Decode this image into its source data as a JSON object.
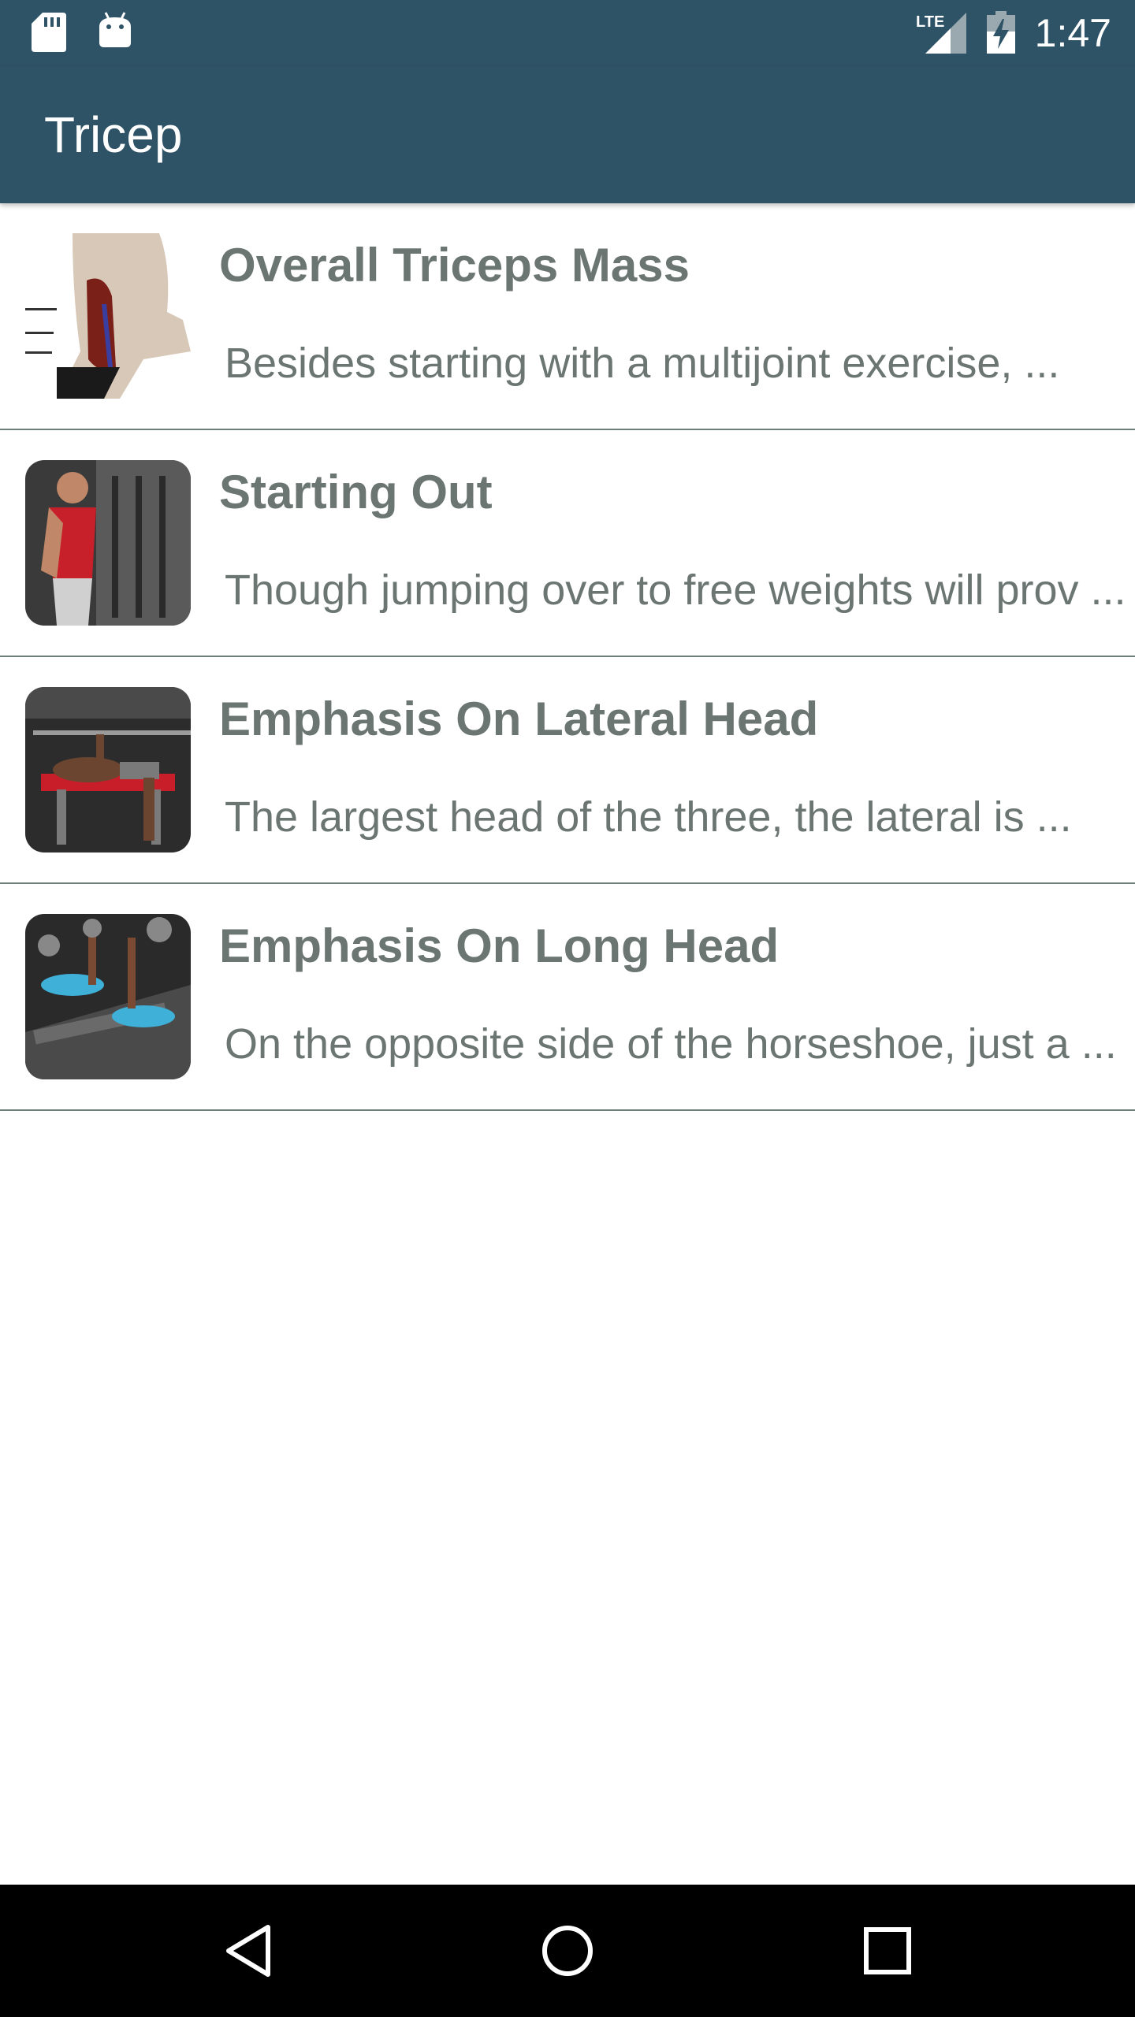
{
  "status_bar": {
    "time": "1:47",
    "network": "LTE",
    "icons": [
      "sd-card-icon",
      "android-icon",
      "lte-signal-icon",
      "battery-charging-icon"
    ]
  },
  "app_bar": {
    "title": "Tricep"
  },
  "items": [
    {
      "title": "Overall Triceps Mass",
      "description": "Besides starting with a multijoint exercise,  ...",
      "thumbnail": "triceps-anatomy-image"
    },
    {
      "title": "Starting Out",
      "description": "Though jumping over to free weights will prov ...",
      "thumbnail": "cable-pushdown-image"
    },
    {
      "title": "Emphasis On Lateral Head",
      "description": "The largest head of the three, the lateral is ...",
      "thumbnail": "close-grip-bench-image"
    },
    {
      "title": "Emphasis On Long Head",
      "description": "On the opposite side of the horseshoe, just a ...",
      "thumbnail": "dumbbell-extension-image"
    }
  ],
  "nav_bar": {
    "icons": [
      "back-icon",
      "home-icon",
      "recents-icon"
    ]
  },
  "colors": {
    "primary": "#2e5266",
    "text": "#6b7572",
    "divider": "#6e7e78"
  }
}
